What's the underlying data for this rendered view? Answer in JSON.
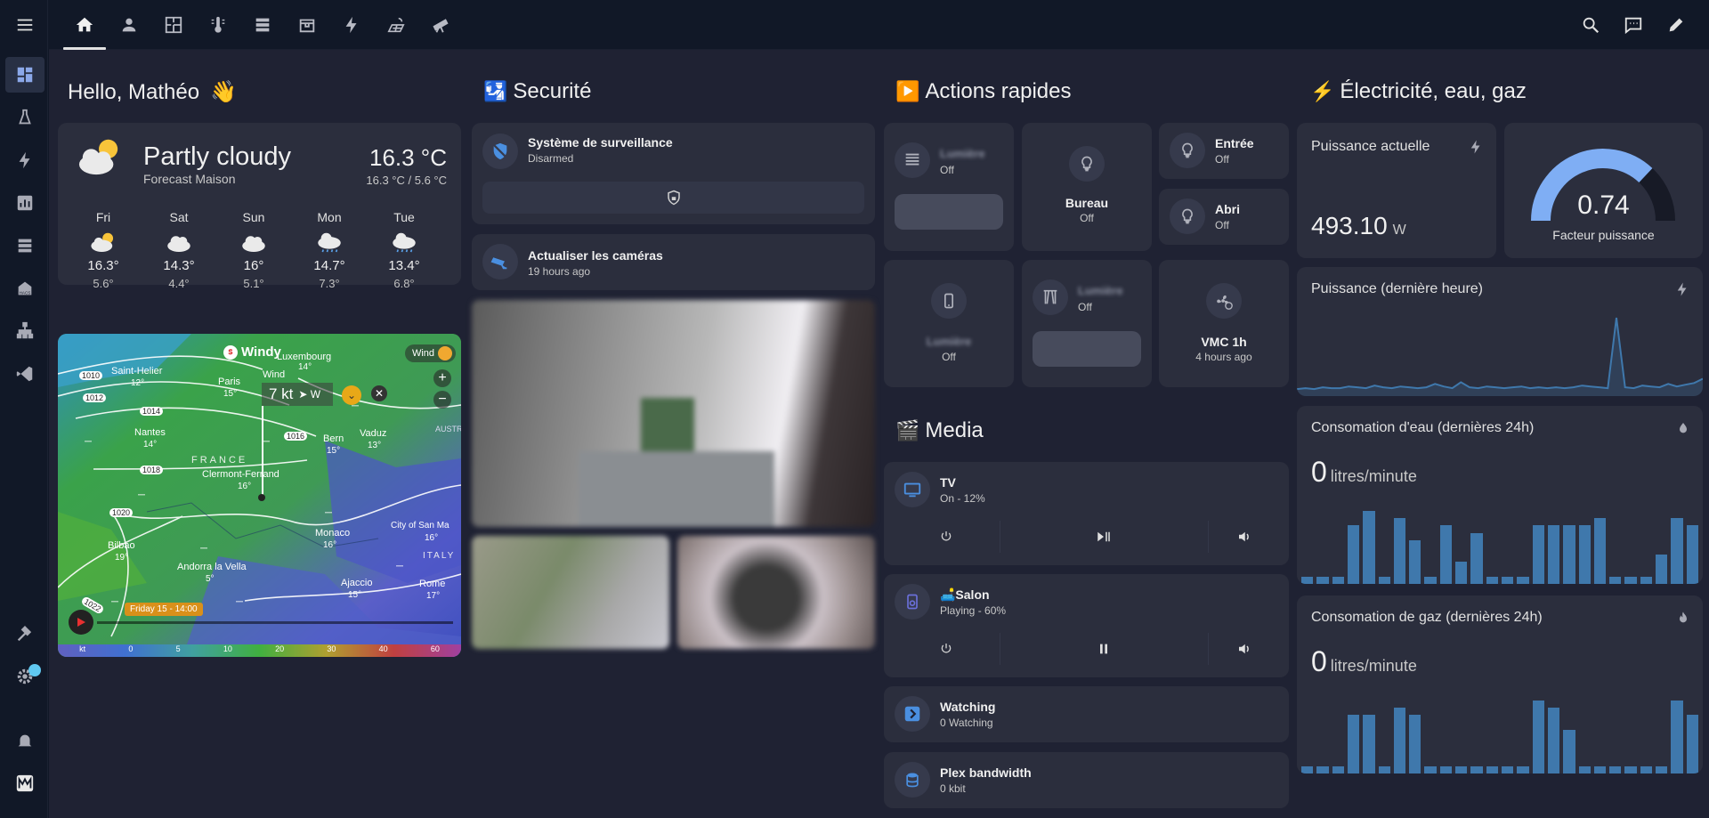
{
  "topbar": {
    "tabs": [
      "home-icon",
      "person-icon",
      "floorplan-icon",
      "thermometer-icon",
      "server-icon",
      "printer-3d-icon",
      "lightning-icon",
      "solar-panel-icon",
      "telescope-icon"
    ],
    "right": [
      "search-icon",
      "assist-icon",
      "edit-icon"
    ]
  },
  "sidebar": {
    "items": [
      "dashboard-icon",
      "flask-icon",
      "lightning-icon",
      "chart-icon",
      "server-icon",
      "hacs-icon",
      "network-icon",
      "vscode-icon"
    ],
    "bottom": [
      "hammer-icon",
      "cog-icon",
      "bell-icon",
      "avatar"
    ]
  },
  "columns": {
    "col1": {
      "title": "Hello, Mathéo",
      "emoji": "👋"
    },
    "col2": {
      "title": "Securité",
      "emoji": "🛂"
    },
    "col3": {
      "title": "Actions rapides",
      "emoji": "▶️"
    },
    "col4": {
      "title": "Électricité, eau, gaz",
      "emoji": "⚡"
    }
  },
  "weather": {
    "condition": "Partly cloudy",
    "source": "Forecast Maison",
    "temp": "16.3 °C",
    "range": "16.3 °C / 5.6 °C",
    "forecast": [
      {
        "day": "Fri",
        "hi": "16.3°",
        "lo": "5.6°",
        "icon": "partly-cloudy"
      },
      {
        "day": "Sat",
        "hi": "14.3°",
        "lo": "4.4°",
        "icon": "cloudy"
      },
      {
        "day": "Sun",
        "hi": "16°",
        "lo": "5.1°",
        "icon": "cloudy"
      },
      {
        "day": "Mon",
        "hi": "14.7°",
        "lo": "7.3°",
        "icon": "rainy"
      },
      {
        "day": "Tue",
        "hi": "13.4°",
        "lo": "6.8°",
        "icon": "rainy"
      }
    ]
  },
  "map": {
    "logo": "Windy",
    "layer": "Wind",
    "wind_label": "Wind",
    "wind_value": "7 kt",
    "wind_dir": "➤ W",
    "date_label": "Friday 15 - 14:00",
    "places": [
      "Luxembourg",
      "Saint-Helier",
      "Paris",
      "Nantes",
      "Bern",
      "Vaduz",
      "Clermont-Ferrand",
      "FRANCE",
      "Monaco",
      "Bilbao",
      "Andorra la Vella",
      "City of San Ma",
      "ITALY",
      "Ajaccio",
      "Rome",
      "AUSTR"
    ],
    "place_temps": [
      "14°",
      "12°",
      "15°",
      "14°",
      "15°",
      "13°",
      "16°",
      "16°",
      "19°",
      "5°",
      "15°",
      "16°",
      "17°"
    ],
    "isobars": [
      "1010",
      "1012",
      "1014",
      "1016",
      "1018",
      "1020",
      "1022"
    ],
    "scale": [
      "kt",
      "0",
      "5",
      "10",
      "20",
      "30",
      "40",
      "60"
    ]
  },
  "security": {
    "alarm": {
      "name": "Système de surveillance",
      "state": "Disarmed"
    },
    "cameras": {
      "name": "Actualiser les caméras",
      "state": "19 hours ago"
    }
  },
  "actions": {
    "a1": {
      "name": "Lumière",
      "state": "Off"
    },
    "bureau": {
      "name": "Bureau",
      "state": "Off"
    },
    "entree": {
      "name": "Entrée",
      "state": "Off"
    },
    "abri": {
      "name": "Abri",
      "state": "Off"
    },
    "a5": {
      "name": "Lumière",
      "state": "Off"
    },
    "a6": {
      "name": "Lumière",
      "state": "Off"
    },
    "vmc": {
      "name": "VMC 1h",
      "state": "4 hours ago"
    }
  },
  "media": {
    "title": "Media",
    "emoji": "🎬",
    "tv": {
      "name": "TV",
      "state": "On - 12%"
    },
    "salon": {
      "name": "🛋️Salon",
      "state": "Playing - 60%"
    },
    "watching": {
      "name": "Watching",
      "state": "0 Watching"
    },
    "plex": {
      "name": "Plex bandwidth",
      "state": "0 kbit"
    }
  },
  "energy": {
    "power": {
      "label": "Puissance actuelle",
      "value": "493.10",
      "unit": "W"
    },
    "gauge": {
      "value": "0.74",
      "label": "Facteur puissance",
      "fraction": 0.74
    },
    "power_hour": {
      "label": "Puissance (dernière heure)"
    },
    "water": {
      "label": "Consomation d'eau (dernières 24h)",
      "value": "0",
      "unit": "litres/minute"
    },
    "gas": {
      "label": "Consomation de gaz (dernières 24h)",
      "value": "0",
      "unit": "litres/minute"
    }
  },
  "colors": {
    "accent": "#44739e",
    "bar": "#3f78ac",
    "gauge": "#7faef4",
    "card": "#2b2e3d"
  },
  "chart_data": [
    {
      "type": "line",
      "title": "Puissance (dernière heure)",
      "values": [
        2,
        3,
        2,
        4,
        3,
        3,
        5,
        4,
        3,
        6,
        4,
        3,
        5,
        4,
        3,
        4,
        8,
        5,
        3,
        10,
        4,
        3,
        5,
        4,
        3,
        4,
        5,
        3,
        4,
        3,
        4,
        3,
        4,
        6,
        5,
        4,
        3,
        85,
        4,
        3,
        6,
        5,
        4,
        8,
        5,
        7,
        9,
        14
      ]
    },
    {
      "type": "bar",
      "title": "Consomation d'eau (dernières 24h)",
      "values": [
        1,
        1,
        1,
        8,
        10,
        1,
        9,
        6,
        1,
        8,
        3,
        7,
        1,
        1,
        1,
        8,
        8,
        8,
        8,
        9,
        1,
        1,
        1,
        4,
        9,
        8
      ]
    },
    {
      "type": "bar",
      "title": "Consomation de gaz (dernières 24h)",
      "values": [
        1,
        1,
        1,
        8,
        8,
        1,
        9,
        8,
        1,
        1,
        1,
        1,
        1,
        1,
        1,
        10,
        9,
        6,
        1,
        1,
        1,
        1,
        1,
        1,
        10,
        8
      ]
    }
  ]
}
